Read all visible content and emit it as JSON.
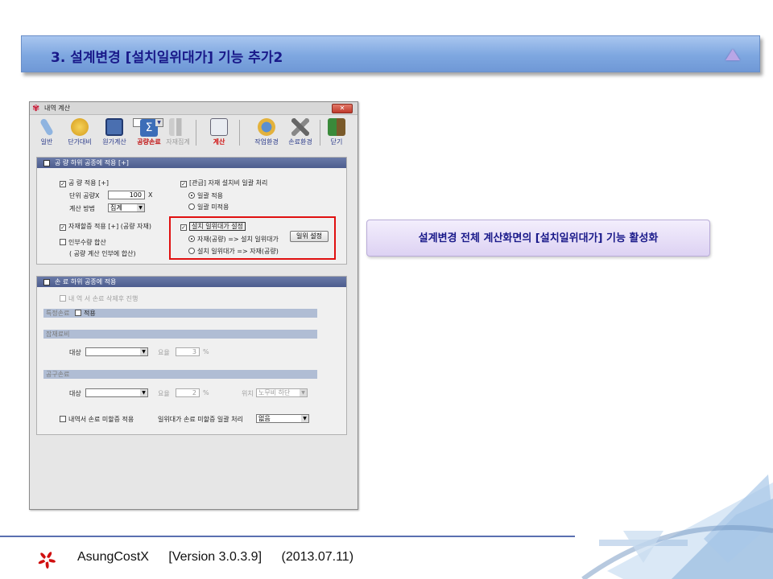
{
  "banner": {
    "title": "3. 설계변경 [설치일위대가] 기능 추가2"
  },
  "window": {
    "title": "내역 계산",
    "toolbar": [
      {
        "label": "일반"
      },
      {
        "label": "단가대비"
      },
      {
        "label": "원가계산"
      },
      {
        "label": "공량손료"
      },
      {
        "label": "자재집계"
      },
      {
        "label": "계산"
      },
      {
        "label": "작업환경"
      },
      {
        "label": "손료환경"
      },
      {
        "label": "닫기"
      }
    ],
    "section1": {
      "header": "공 량 하위 공종에 적용 [+]",
      "gongryang": "공    량 적용 [+]",
      "unit_label": "단위 공량X",
      "unit_value": "100",
      "unit_suffix": "X",
      "method_label": "계산 방법",
      "method_value": "집계",
      "jaejae": "자재할증 적용 [+] (공량 자재)",
      "inbu": "인부수량 합산",
      "inbu_note": "( 공량 계산 인부에 합산)",
      "gwangeup": "[관급] 자재 설치비 일괄 처리",
      "radio_apply": "일괄 적용",
      "radio_noapply": "일괄 미적용",
      "seolchi": "설치 일위대가 설정",
      "opt1": "자재(공량) => 설치 일위대가",
      "opt2": "설치 일위대가 => 자재(공량)",
      "btn_setting": "일위 설정"
    },
    "section2": {
      "header": "손 료 하위 공종에 적용",
      "delete_note": "내 역 서 손료 삭제후 진행",
      "bar1": "특정손료",
      "apply": "적용",
      "bar2": "잡재료비",
      "target": "대상",
      "rate": "요율",
      "rate1_value": "3",
      "pct": "%",
      "bar3": "공구손료",
      "rate2_value": "2",
      "position": "위치",
      "position_value": "노무비 하단",
      "missing": "내역서 손료 미할증 적용",
      "ilwi_label": "일위대가 손료 미할증 일괄 처리",
      "ilwi_value": "없음"
    }
  },
  "callout": "설계변경 전체 계산화면의 [설치일위대가] 기능 활성화",
  "footer": {
    "app": "AsungCostX",
    "version": "[Version 3.0.3.9]",
    "date": "(2013.07.11)"
  },
  "colors": {
    "banner_text": "#1a1a8a",
    "highlight": "#e01010",
    "accent": "#5a6fb0"
  }
}
